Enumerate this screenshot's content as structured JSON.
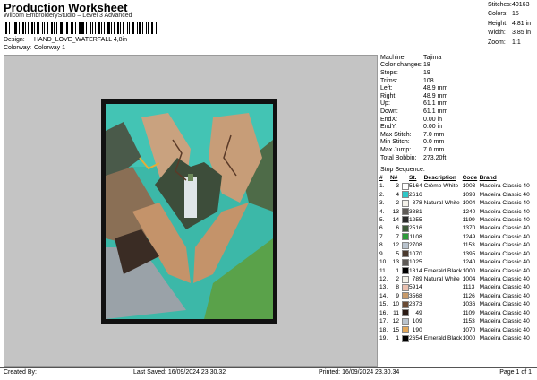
{
  "header": {
    "title": "Production Worksheet",
    "software": "Wilcom EmbroideryStudio – Level 3 Advanced",
    "design_label": "Design:",
    "design_value": "HAND_LOVE_WATERFALL 4,8in",
    "colorway_label": "Colorway:",
    "colorway_value": "Colorway 1"
  },
  "stats": [
    {
      "label": "Stitches:",
      "value": "40163"
    },
    {
      "label": "Colors:",
      "value": "15"
    },
    {
      "label": "Height:",
      "value": "4.81 in"
    },
    {
      "label": "Width:",
      "value": "3.85 in"
    },
    {
      "label": "Zoom:",
      "value": "1:1"
    }
  ],
  "properties": [
    {
      "label": "Machine:",
      "value": "Tajima"
    },
    {
      "label": "Color changes:",
      "value": "18"
    },
    {
      "label": "Stops:",
      "value": "19"
    },
    {
      "label": "Trims:",
      "value": "108"
    },
    {
      "label": "Left:",
      "value": "48.9 mm"
    },
    {
      "label": "Right:",
      "value": "48.9 mm"
    },
    {
      "label": "Up:",
      "value": "61.1 mm"
    },
    {
      "label": "Down:",
      "value": "61.1 mm"
    },
    {
      "label": "EndX:",
      "value": "0.00 in"
    },
    {
      "label": "EndY:",
      "value": "0.00 in"
    },
    {
      "label": "Max Stitch:",
      "value": "7.0 mm"
    },
    {
      "label": "Min Stitch:",
      "value": "0.0 mm"
    },
    {
      "label": "Max Jump:",
      "value": "7.0 mm"
    },
    {
      "label": "Total Bobbin:",
      "value": "273.20ft"
    }
  ],
  "stop_sequence_label": "Stop Sequence:",
  "stop_columns": {
    "no": "#",
    "n": "N#",
    "st": "St.",
    "desc": "Description",
    "code": "Code",
    "brand": "Brand"
  },
  "stops": [
    {
      "no": "1.",
      "n": "3",
      "color": "#ffffff",
      "st": "5164",
      "desc": "Crème White",
      "code": "1003",
      "brand": "Madeira Classic 40"
    },
    {
      "no": "2.",
      "n": "4",
      "color": "#2fc6c6",
      "st": "2616",
      "desc": "",
      "code": "1093",
      "brand": "Madeira Classic 40"
    },
    {
      "no": "3.",
      "n": "2",
      "color": "#f4f2ea",
      "st": "878",
      "desc": "Natural White",
      "code": "1004",
      "brand": "Madeira Classic 40"
    },
    {
      "no": "4.",
      "n": "13",
      "color": "#5e5a56",
      "st": "3881",
      "desc": "",
      "code": "1240",
      "brand": "Madeira Classic 40"
    },
    {
      "no": "5.",
      "n": "14",
      "color": "#2a2a2a",
      "st": "1255",
      "desc": "",
      "code": "1199",
      "brand": "Madeira Classic 40"
    },
    {
      "no": "6.",
      "n": "6",
      "color": "#3f5a3a",
      "st": "2516",
      "desc": "",
      "code": "1370",
      "brand": "Madeira Classic 40"
    },
    {
      "no": "7.",
      "n": "7",
      "color": "#2e9a3a",
      "st": "1108",
      "desc": "",
      "code": "1249",
      "brand": "Madeira Classic 40"
    },
    {
      "no": "8.",
      "n": "12",
      "color": "#b9c3cd",
      "st": "2708",
      "desc": "",
      "code": "1153",
      "brand": "Madeira Classic 40"
    },
    {
      "no": "9.",
      "n": "5",
      "color": "#4a3a2e",
      "st": "1070",
      "desc": "",
      "code": "1395",
      "brand": "Madeira Classic 40"
    },
    {
      "no": "10.",
      "n": "13",
      "color": "#5e5a56",
      "st": "1025",
      "desc": "",
      "code": "1240",
      "brand": "Madeira Classic 40"
    },
    {
      "no": "11.",
      "n": "1",
      "color": "#000000",
      "st": "1814",
      "desc": "Emerald Black",
      "code": "1000",
      "brand": "Madeira Classic 40"
    },
    {
      "no": "12.",
      "n": "2",
      "color": "#f4f2ea",
      "st": "789",
      "desc": "Natural White",
      "code": "1004",
      "brand": "Madeira Classic 40"
    },
    {
      "no": "13.",
      "n": "8",
      "color": "#e9bfae",
      "st": "5914",
      "desc": "",
      "code": "1113",
      "brand": "Madeira Classic 40"
    },
    {
      "no": "14.",
      "n": "9",
      "color": "#c79a6a",
      "st": "3568",
      "desc": "",
      "code": "1126",
      "brand": "Madeira Classic 40"
    },
    {
      "no": "15.",
      "n": "10",
      "color": "#6a4b34",
      "st": "2873",
      "desc": "",
      "code": "1036",
      "brand": "Madeira Classic 40"
    },
    {
      "no": "16.",
      "n": "11",
      "color": "#2a1a14",
      "st": "49",
      "desc": "",
      "code": "1109",
      "brand": "Madeira Classic 40"
    },
    {
      "no": "17.",
      "n": "12",
      "color": "#b9c3cd",
      "st": "109",
      "desc": "",
      "code": "1153",
      "brand": "Madeira Classic 40"
    },
    {
      "no": "18.",
      "n": "15",
      "color": "#e1a75a",
      "st": "190",
      "desc": "",
      "code": "1070",
      "brand": "Madeira Classic 40"
    },
    {
      "no": "19.",
      "n": "1",
      "color": "#000000",
      "st": "2654",
      "desc": "Emerald Black",
      "code": "1000",
      "brand": "Madeira Classic 40"
    }
  ],
  "footer": {
    "created_by": "Created By:",
    "last_saved": "Last Saved: 16/09/2024 23.30.32",
    "printed": "Printed: 16/09/2024 23.30.34",
    "page": "Page 1 of 1"
  }
}
